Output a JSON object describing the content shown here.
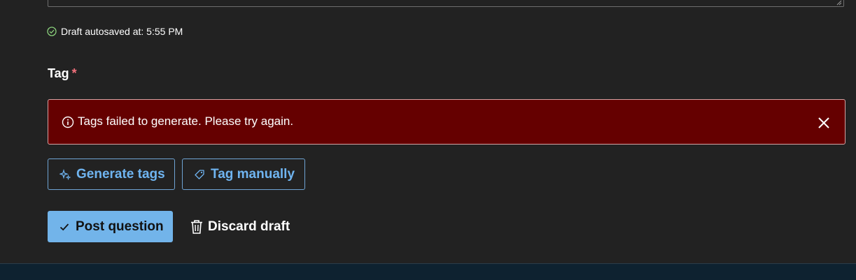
{
  "autosave": {
    "text": "Draft autosaved at: 5:55 PM",
    "icon": "check-circle-icon",
    "icon_color": "#8bd17c"
  },
  "tag": {
    "label": "Tag",
    "required_mark": "*",
    "required_color": "#f1707b"
  },
  "error_banner": {
    "message": "Tags failed to generate. Please try again.",
    "icon": "info-icon",
    "close_icon": "close-icon",
    "background": "#650000"
  },
  "buttons": {
    "generate_tags": "Generate tags",
    "tag_manually": "Tag manually",
    "post_question": "Post question",
    "discard_draft": "Discard draft"
  },
  "colors": {
    "page_background": "#222222",
    "accent": "#6fb4f0",
    "primary_button": "#72b4ea",
    "footer": "#0e2230"
  }
}
